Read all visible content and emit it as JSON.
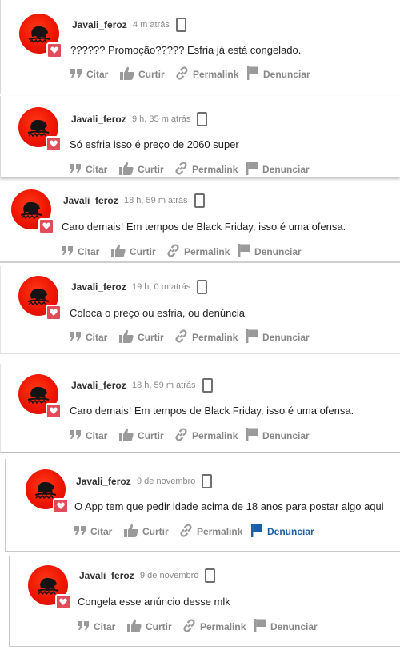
{
  "theme": {
    "accent": "#f7a24b",
    "avatar_red": "#ee1500",
    "badge_color": "#e24c5a",
    "active_link": "#1a5fa8"
  },
  "icons": {
    "device": "smartphone-icon",
    "cite": "quote-icon",
    "like": "thumbs-up-icon",
    "permalink": "link-icon",
    "report": "flag-icon",
    "badge": "heart-icon"
  },
  "actions": {
    "cite": "Citar",
    "like": "Curtir",
    "permalink": "Permalink",
    "report": "Denunciar"
  },
  "comments": [
    {
      "author": "Javali_feroz",
      "time": "4 m atrás",
      "text": "?????? Promoção????? Esfria já está congelado.",
      "report_active": false
    },
    {
      "author": "Javali_feroz",
      "time": "9 h, 35 m atrás",
      "text": "Só esfria isso é preço de 2060 super",
      "report_active": false
    },
    {
      "author": "Javali_feroz",
      "time": "18 h, 59 m atrás",
      "text": "Caro demais! Em tempos de Black Friday, isso é uma ofensa.",
      "report_active": false
    },
    {
      "author": "Javali_feroz",
      "time": "19 h, 0 m atrás",
      "text": "Coloca o preço ou esfria, ou denúncia",
      "report_active": false
    },
    {
      "author": "Javali_feroz",
      "time": "18 h, 59 m atrás",
      "text": "Caro demais! Em tempos de Black Friday, isso é uma ofensa.",
      "report_active": false
    },
    {
      "author": "Javali_feroz",
      "time": "9 de novembro",
      "text": "O App tem que pedir idade acima de 18 anos para postar algo aqui",
      "report_active": true
    },
    {
      "author": "Javali_feroz",
      "time": "9 de novembro",
      "text": "Congela esse anúncio desse mlk",
      "report_active": false
    }
  ]
}
